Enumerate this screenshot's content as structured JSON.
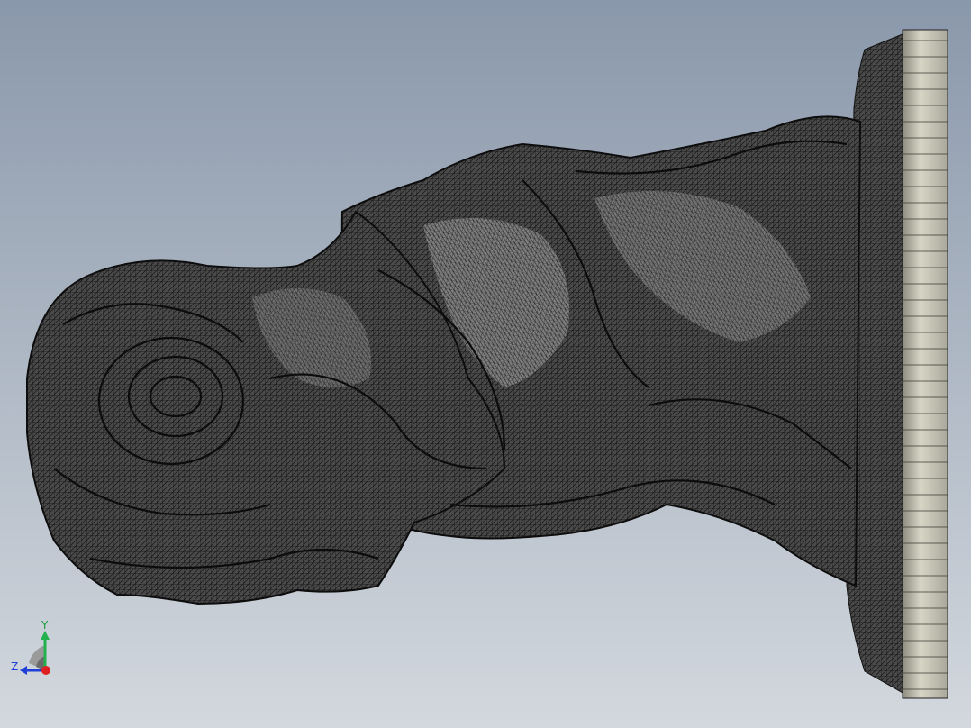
{
  "viewport": {
    "background_top": "#8a98ab",
    "background_bottom": "#d3d8de",
    "display_mode": "wireframe",
    "model": "bust-statue-on-base"
  },
  "model_colors": {
    "wire": "#1e1e1e",
    "surface": "#5a5a5a",
    "base_fill": "#c9c8b8",
    "base_shadow": "#8c8b7e"
  },
  "triad": {
    "y_label": "Y",
    "z_label": "Z",
    "y_color": "#22b14c",
    "z_color": "#1f3fd8",
    "x_color": "#e02020"
  }
}
